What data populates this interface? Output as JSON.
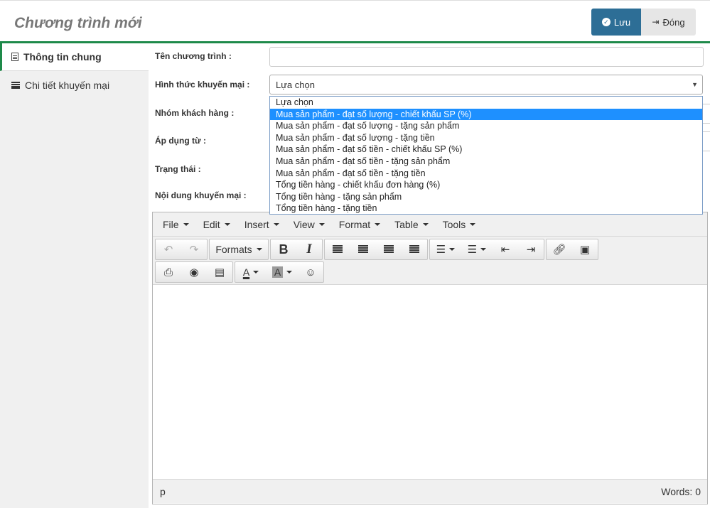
{
  "header": {
    "title": "Chương trình mới",
    "save_label": "Lưu",
    "close_label": "Đóng"
  },
  "sidebar": {
    "items": [
      {
        "label": "Thông tin chung",
        "icon": "document-icon",
        "active": true
      },
      {
        "label": "Chi tiết khuyến mại",
        "icon": "list-icon",
        "active": false
      }
    ]
  },
  "form": {
    "name_label": "Tên chương trình :",
    "name_value": "",
    "type_label": "Hình thức khuyến mại :",
    "type_value": "Lựa chọn",
    "customer_group_label": "Nhóm khách hàng :",
    "apply_from_label": "Áp dụng từ :",
    "status_label": "Trạng thái :",
    "content_label": "Nội dung khuyến mại :"
  },
  "dropdown": {
    "options": [
      "Lựa chọn",
      "Mua sản phẩm - đạt số lượng - chiết khấu SP (%)",
      "Mua sản phẩm - đạt số lượng - tặng sản phẩm",
      "Mua sản phẩm - đạt số lượng - tặng tiền",
      "Mua sản phẩm - đạt số tiền - chiết khấu SP (%)",
      "Mua sản phẩm - đạt số tiền - tặng sản phẩm",
      "Mua sản phẩm - đạt số tiền - tặng tiền",
      "Tổng tiền hàng - chiết khấu đơn hàng (%)",
      "Tổng tiền hàng - tặng sản phẩm",
      "Tổng tiền hàng - tặng tiền"
    ],
    "highlighted": "Mua sản phẩm - đạt số lượng - chiết khấu SP (%)"
  },
  "editor": {
    "menu": [
      "File",
      "Edit",
      "Insert",
      "View",
      "Format",
      "Table",
      "Tools"
    ],
    "formats_label": "Formats",
    "bold_label": "B",
    "italic_label": "I",
    "text_color_label": "A",
    "bg_color_label": "A",
    "path": "p",
    "word_count": "Words: 0"
  },
  "colors": {
    "accent": "#1e8a4a",
    "save_button": "#2d6e96",
    "dropdown_highlight": "#1e90ff"
  }
}
